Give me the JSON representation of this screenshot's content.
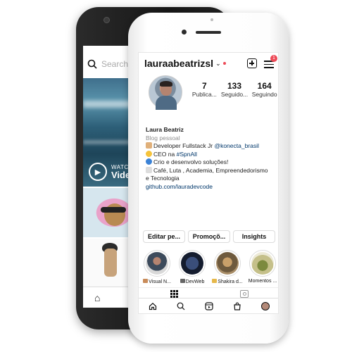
{
  "back_app": {
    "search_placeholder": "Search",
    "watch_small": "WATCH",
    "watch_big": "Video"
  },
  "profile": {
    "username": "lauraabeatrizsl",
    "notification_count": "1",
    "stats": [
      {
        "value": "7",
        "label": "Publica..."
      },
      {
        "value": "133",
        "label": "Seguido..."
      },
      {
        "value": "164",
        "label": "Seguindo"
      }
    ],
    "name": "Laura Beatriz",
    "category": "Blog pessoal",
    "bio": {
      "line1_text": "Developer Fullstack Jr ",
      "line1_link": "@konecta_brasil",
      "line2_text": "CEO na ",
      "line2_link": "#SpnAll",
      "line3_text": "Crio e desenvolvo soluções!",
      "line4_text": "Café, Luta , Academia, Empreendedorismo",
      "line5_text": "e Tecnologia",
      "link": "github.com/lauradevcode"
    },
    "buttons": {
      "edit": "Editar pe...",
      "promo": "Promoçõ...",
      "insights": "Insights"
    },
    "highlights": [
      {
        "label": "Visual N..."
      },
      {
        "label": "DevWeb"
      },
      {
        "label": "Shakira d..."
      },
      {
        "label": "Momentos ..."
      }
    ]
  },
  "colors": {
    "accent_red": "#ed4956",
    "link_blue": "#00376b"
  },
  "icons": {
    "header": [
      "plus-square-icon",
      "hamburger-menu-icon"
    ],
    "tabs": [
      "grid-icon",
      "tagged-icon"
    ],
    "nav": [
      "home-icon",
      "search-icon",
      "reels-icon",
      "shop-icon",
      "profile-avatar-icon"
    ]
  }
}
